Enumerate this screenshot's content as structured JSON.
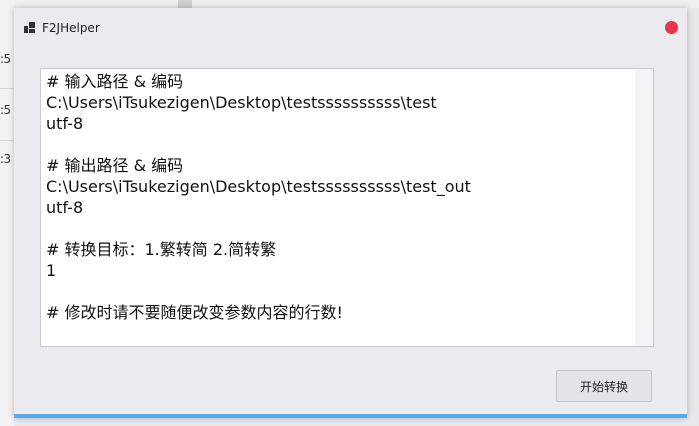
{
  "window": {
    "title": "F2JHelper",
    "icon": "app-icon",
    "close_color": "#e8344f",
    "accent": "#5aa8e8"
  },
  "editor": {
    "content": "# 输入路径 & 编码\nC:\\Users\\iTsukezigen\\Desktop\\testssssssssss\\test\nutf-8\n\n# 输出路径 & 编码\nC:\\Users\\iTsukezigen\\Desktop\\testssssssssss\\test_out\nutf-8\n\n# 转换目标：1.繁转简 2.简转繁\n1\n\n# 修改时请不要随便改变参数内容的行数!"
  },
  "actions": {
    "start_label": "开始转换"
  },
  "background": {
    "left_fragments": [
      ":5",
      ":5",
      ":3"
    ]
  }
}
